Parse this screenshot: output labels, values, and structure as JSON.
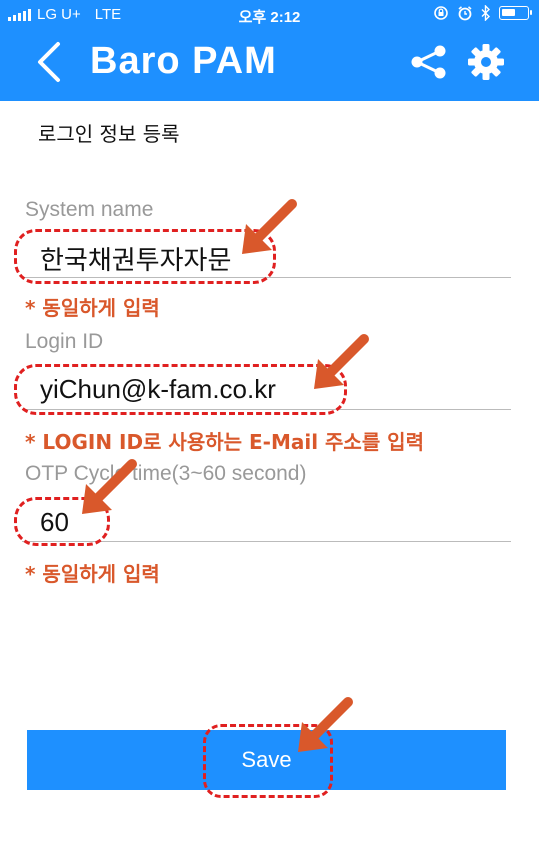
{
  "status_bar": {
    "carrier": "LG U+",
    "network": "LTE",
    "time": "오후 2:12",
    "battery_level": 0.55
  },
  "header": {
    "title": "Baro PAM",
    "back_icon": "chevron-left-icon",
    "share_icon": "share-icon",
    "settings_icon": "gear-icon"
  },
  "page": {
    "section_title": "로그인 정보 등록"
  },
  "form": {
    "system_name": {
      "label": "System name",
      "value": "한국채권투자자문",
      "note": "* 동일하게 입력"
    },
    "login_id": {
      "label": "Login ID",
      "value": "yiChun@k-fam.co.kr",
      "note": "* LOGIN ID로 사용하는 E-Mail 주소를 입력"
    },
    "otp_cycle": {
      "label": "OTP Cycle time(3~60 second)",
      "value": "60",
      "note": "* 동일하게 입력"
    },
    "save_label": "Save"
  },
  "colors": {
    "brand": "#1e90ff",
    "annotation": "#d9582b",
    "highlight": "#e02020"
  }
}
